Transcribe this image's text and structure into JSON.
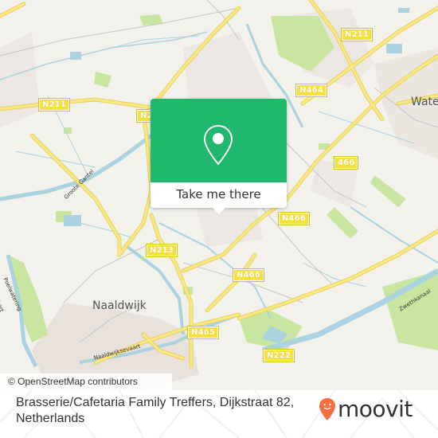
{
  "map": {
    "attribution": "© OpenStreetMap contributors",
    "place_labels": [
      {
        "name": "Naaldwijk"
      },
      {
        "name": "Wate"
      }
    ],
    "road_shields": [
      {
        "label": "N211"
      },
      {
        "label": "N211"
      },
      {
        "label": "N2"
      },
      {
        "label": "N464"
      },
      {
        "label": "466"
      },
      {
        "label": "N466"
      },
      {
        "label": "N466"
      },
      {
        "label": "N213"
      },
      {
        "label": "N465"
      },
      {
        "label": "N222"
      }
    ],
    "street_labels": [
      {
        "name": "Groote Gantel"
      },
      {
        "name": "Naaldwijksevaart"
      },
      {
        "name": "Zwethkanaal"
      },
      {
        "name": "Poelwatering"
      },
      {
        "name": "Vaart"
      }
    ],
    "colors": {
      "land": "#f2f1ec",
      "water": "#aad3df",
      "road": "#f6e23a",
      "park": "#c8e6a0",
      "urban": "#e8e1dc"
    }
  },
  "popup": {
    "icon": "location-pin-icon",
    "action_label": "Take me there",
    "color": "#1fb86c"
  },
  "footer": {
    "address": "Brasserie/Cafetaria Family Treffers, Dijkstraat 82, Netherlands",
    "brand": "moovit",
    "brand_color": "#f36f3d"
  }
}
